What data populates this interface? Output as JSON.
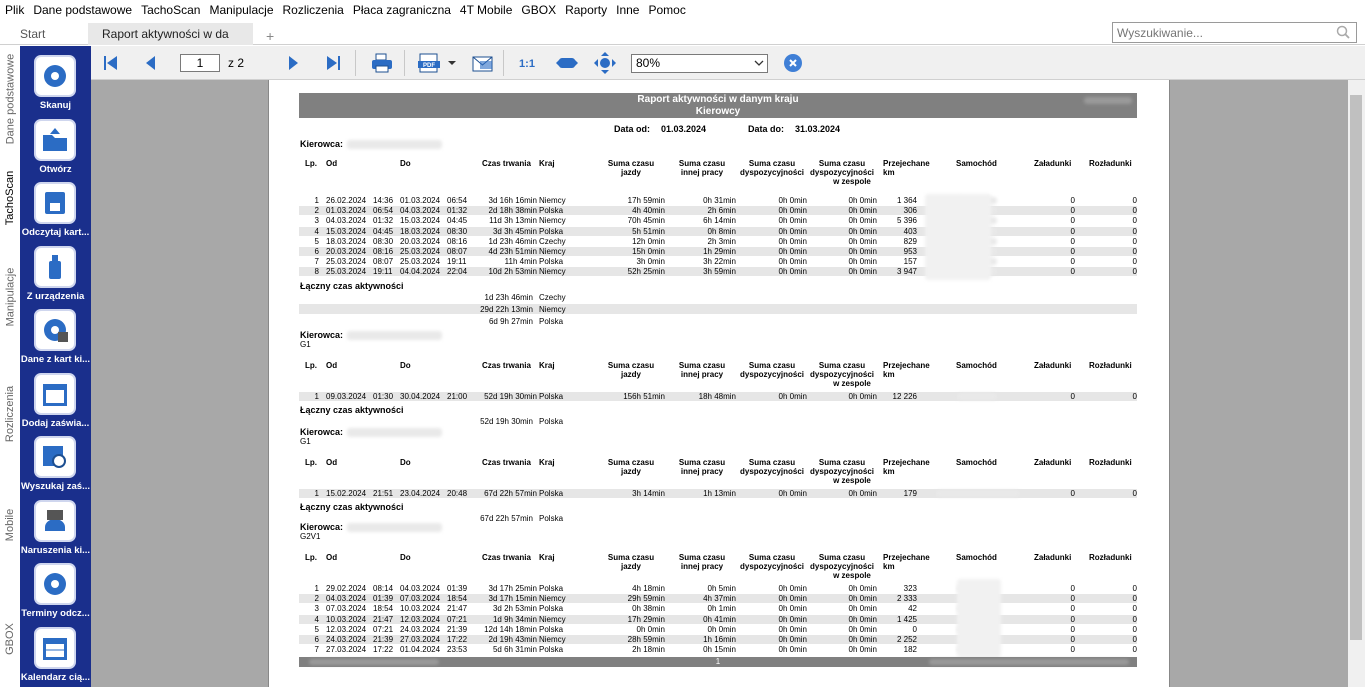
{
  "menu": [
    "Plik",
    "Dane podstawowe",
    "TachoScan",
    "Manipulacje",
    "Rozliczenia",
    "Płaca zagraniczna",
    "4T Mobile",
    "GBOX",
    "Raporty",
    "Inne",
    "Pomoc"
  ],
  "tabs": {
    "start": "Start",
    "report": "Raport aktywności w da",
    "add": "+"
  },
  "search": {
    "placeholder": "Wyszukiwanie..."
  },
  "vtabs": [
    "Dane podstawowe",
    "TachoScan",
    "Manipulacje",
    "Rozliczenia",
    "Mobile",
    "GBOX"
  ],
  "sidebar": [
    "Skanuj",
    "Otwórz",
    "Odczytaj kart...",
    "Z urządzenia",
    "Dane z kart ki...",
    "Dodaj zaświa...",
    "Wyszukaj zaś...",
    "Naruszenia ki...",
    "Terminy odcz...",
    "Kalendarz cią..."
  ],
  "toolbar": {
    "page": "1",
    "of": "z 2",
    "zoom": "80%"
  },
  "report": {
    "title1": "Raport aktywności w danym kraju",
    "title2": "Kierowcy",
    "date_from_label": "Data od:",
    "date_from": "01.03.2024",
    "date_to_label": "Data do:",
    "date_to": "31.03.2024",
    "driver_label": "Kierowca:",
    "total_label": "Łączny czas aktywności",
    "footer_page": "1",
    "headers": {
      "lp": "Lp.",
      "od": "Od",
      "do": "Do",
      "czas": "Czas trwania",
      "kraj": "Kraj",
      "sj1": "Suma czasu",
      "sj2": "jazdy",
      "si1": "Suma czasu",
      "si2": "innej pracy",
      "sd1": "Suma czasu",
      "sd2": "dyspozycyjności",
      "sz1": "Suma czasu",
      "sz2": "dyspozycyjności",
      "sz3": "w zespole",
      "pk1": "Przejechane",
      "pk2": "km",
      "sam": "Samochód",
      "zal": "Załadunki",
      "roz": "Rozładunki"
    },
    "sections": [
      {
        "group": "",
        "rows": [
          [
            "1",
            "26.02.2024",
            "14:36",
            "01.03.2024",
            "06:54",
            "3d 16h 16min",
            "Niemcy",
            "17h 59min",
            "0h 31min",
            "0h 0min",
            "0h 0min",
            "1 364",
            "0",
            "0"
          ],
          [
            "2",
            "01.03.2024",
            "06:54",
            "04.03.2024",
            "01:32",
            "2d 18h 38min",
            "Polska",
            "4h 40min",
            "2h 6min",
            "0h 0min",
            "0h 0min",
            "306",
            "0",
            "0"
          ],
          [
            "3",
            "04.03.2024",
            "01:32",
            "15.03.2024",
            "04:45",
            "11d 3h 13min",
            "Niemcy",
            "70h 45min",
            "6h 14min",
            "0h 0min",
            "0h 0min",
            "5 396",
            "0",
            "0"
          ],
          [
            "4",
            "15.03.2024",
            "04:45",
            "18.03.2024",
            "08:30",
            "3d 3h 45min",
            "Polska",
            "5h 51min",
            "0h 8min",
            "0h 0min",
            "0h 0min",
            "403",
            "0",
            "0"
          ],
          [
            "5",
            "18.03.2024",
            "08:30",
            "20.03.2024",
            "08:16",
            "1d 23h 46min",
            "Czechy",
            "12h 0min",
            "2h 3min",
            "0h 0min",
            "0h 0min",
            "829",
            "0",
            "0"
          ],
          [
            "6",
            "20.03.2024",
            "08:16",
            "25.03.2024",
            "08:07",
            "4d 23h 51min",
            "Niemcy",
            "15h 0min",
            "1h 29min",
            "0h 0min",
            "0h 0min",
            "953",
            "0",
            "0"
          ],
          [
            "7",
            "25.03.2024",
            "08:07",
            "25.03.2024",
            "19:11",
            "11h 4min",
            "Polska",
            "3h 0min",
            "3h 22min",
            "0h 0min",
            "0h 0min",
            "157",
            "0",
            "0"
          ],
          [
            "8",
            "25.03.2024",
            "19:11",
            "04.04.2024",
            "22:04",
            "10d 2h 53min",
            "Niemcy",
            "52h 25min",
            "3h 59min",
            "0h 0min",
            "0h 0min",
            "3 947",
            "0",
            "0"
          ]
        ],
        "totals": [
          [
            "1d 23h 46min",
            "Czechy"
          ],
          [
            "29d 22h 13min",
            "Niemcy"
          ],
          [
            "6d 9h 27min",
            "Polska"
          ]
        ]
      },
      {
        "group": "G1",
        "rows": [
          [
            "1",
            "09.03.2024",
            "01:30",
            "30.04.2024",
            "21:00",
            "52d 19h 30min",
            "Polska",
            "156h 51min",
            "18h 48min",
            "0h 0min",
            "0h 0min",
            "12 226",
            "0",
            "0"
          ]
        ],
        "totals": [
          [
            "52d 19h 30min",
            "Polska"
          ]
        ]
      },
      {
        "group": "G1",
        "rows": [
          [
            "1",
            "15.02.2024",
            "21:51",
            "23.04.2024",
            "20:48",
            "67d 22h 57min",
            "Polska",
            "3h 14min",
            "1h 13min",
            "0h 0min",
            "0h 0min",
            "179",
            "0",
            "0"
          ]
        ],
        "totals": [
          [
            "67d 22h 57min",
            "Polska"
          ]
        ]
      },
      {
        "group": "G2V1",
        "rows": [
          [
            "1",
            "29.02.2024",
            "08:14",
            "04.03.2024",
            "01:39",
            "3d 17h 25min",
            "Polska",
            "4h 18min",
            "0h 5min",
            "0h 0min",
            "0h 0min",
            "323",
            "0",
            "0"
          ],
          [
            "2",
            "04.03.2024",
            "01:39",
            "07.03.2024",
            "18:54",
            "3d 17h 15min",
            "Niemcy",
            "29h 59min",
            "4h 37min",
            "0h 0min",
            "0h 0min",
            "2 333",
            "0",
            "0"
          ],
          [
            "3",
            "07.03.2024",
            "18:54",
            "10.03.2024",
            "21:47",
            "3d 2h 53min",
            "Polska",
            "0h 38min",
            "0h 1min",
            "0h 0min",
            "0h 0min",
            "42",
            "0",
            "0"
          ],
          [
            "4",
            "10.03.2024",
            "21:47",
            "12.03.2024",
            "07:21",
            "1d 9h 34min",
            "Niemcy",
            "17h 29min",
            "0h 41min",
            "0h 0min",
            "0h 0min",
            "1 425",
            "0",
            "0"
          ],
          [
            "5",
            "12.03.2024",
            "07:21",
            "24.03.2024",
            "21:39",
            "12d 14h 18min",
            "Polska",
            "0h 0min",
            "0h 0min",
            "0h 0min",
            "0h 0min",
            "0",
            "0",
            "0"
          ],
          [
            "6",
            "24.03.2024",
            "21:39",
            "27.03.2024",
            "17:22",
            "2d 19h 43min",
            "Niemcy",
            "28h 59min",
            "1h 16min",
            "0h 0min",
            "0h 0min",
            "2 252",
            "0",
            "0"
          ],
          [
            "7",
            "27.03.2024",
            "17:22",
            "01.04.2024",
            "23:53",
            "5d 6h 31min",
            "Polska",
            "2h 18min",
            "0h 15min",
            "0h 0min",
            "0h 0min",
            "182",
            "0",
            "0"
          ]
        ],
        "totals": []
      }
    ]
  }
}
